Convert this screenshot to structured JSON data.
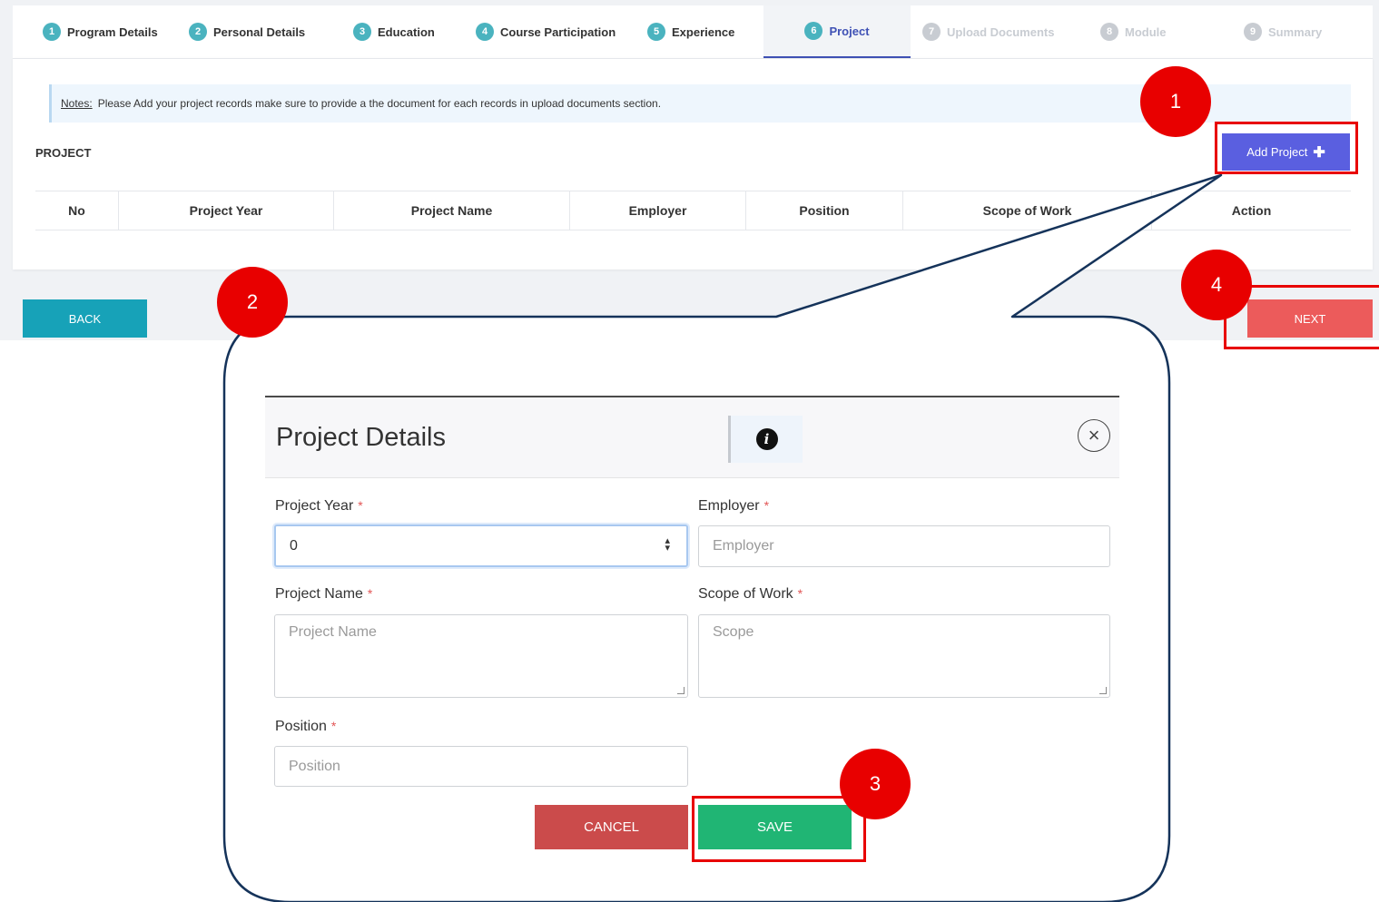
{
  "steps": [
    {
      "num": "1",
      "label": "Program Details",
      "state": "done"
    },
    {
      "num": "2",
      "label": "Personal Details",
      "state": "done"
    },
    {
      "num": "3",
      "label": "Education",
      "state": "done"
    },
    {
      "num": "4",
      "label": "Course Participation",
      "state": "done"
    },
    {
      "num": "5",
      "label": "Experience",
      "state": "done"
    },
    {
      "num": "6",
      "label": "Project",
      "state": "active"
    },
    {
      "num": "7",
      "label": "Upload Documents",
      "state": "disabled"
    },
    {
      "num": "8",
      "label": "Module",
      "state": "disabled"
    },
    {
      "num": "9",
      "label": "Summary",
      "state": "disabled"
    }
  ],
  "notes": {
    "prefix": "Notes:",
    "text": "Please Add your project records make sure to provide a the document for each records in upload documents section."
  },
  "section": {
    "title": "PROJECT"
  },
  "toolbar": {
    "add_label": "Add Project",
    "add_icon": "plus-icon"
  },
  "table": {
    "columns": [
      "No",
      "Project Year",
      "Project Name",
      "Employer",
      "Position",
      "Scope of Work",
      "Action"
    ],
    "rows": []
  },
  "nav": {
    "back_label": "BACK",
    "next_label": "NEXT"
  },
  "annotations": [
    "1",
    "2",
    "3",
    "4"
  ],
  "modal": {
    "title": "Project Details",
    "info_icon": "info-icon",
    "close_icon": "close-icon",
    "fields": {
      "project_year": {
        "label": "Project Year",
        "value": "0"
      },
      "employer": {
        "label": "Employer",
        "placeholder": "Employer"
      },
      "project_name": {
        "label": "Project Name",
        "placeholder": "Project Name"
      },
      "scope": {
        "label": "Scope of Work",
        "placeholder": "Scope"
      },
      "position": {
        "label": "Position",
        "placeholder": "Position"
      }
    },
    "required_marker": "*",
    "cancel_label": "CANCEL",
    "save_label": "SAVE"
  },
  "colors": {
    "accent": "#5a5fe0",
    "step_badge": "#4ab3bf",
    "back": "#17a2b8",
    "next": "#ec5b5b",
    "cancel": "#cb4b4b",
    "save": "#20b574",
    "annotation": "#e80000",
    "callout_outline": "#15335a"
  }
}
